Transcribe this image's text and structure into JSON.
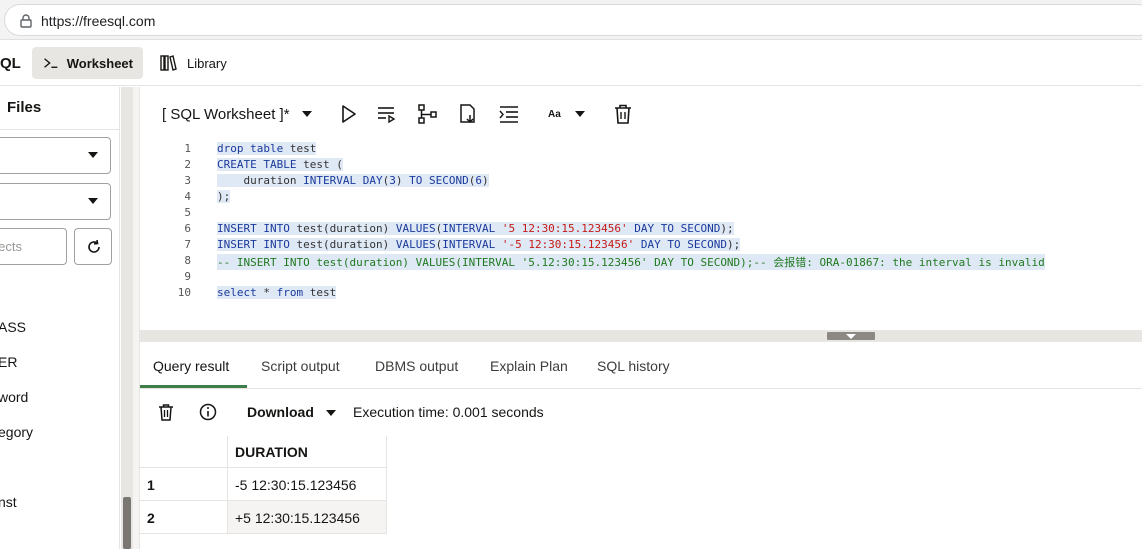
{
  "browser": {
    "url": "https://freesql.com"
  },
  "app": {
    "brand": "QL",
    "tabs": [
      {
        "label": "Worksheet",
        "icon": "terminal-icon",
        "active": true
      },
      {
        "label": "Library",
        "icon": "library-icon",
        "active": false
      }
    ]
  },
  "left_panel": {
    "title": "Files",
    "search_placeholder": "bjects",
    "items": [
      "ASS",
      "ER",
      "word",
      "egory",
      "nst"
    ]
  },
  "editor": {
    "title": "[ SQL Worksheet ]*",
    "font_button": "Aa",
    "line_numbers": [
      "1",
      "2",
      "3",
      "4",
      "5",
      "6",
      "7",
      "8",
      "9",
      "10"
    ],
    "lines": [
      "drop table test",
      "CREATE TABLE test (",
      "    duration INTERVAL DAY(3) TO SECOND(6)",
      ");",
      "",
      "INSERT INTO test(duration) VALUES(INTERVAL '5 12:30:15.123456' DAY TO SECOND);",
      "INSERT INTO test(duration) VALUES(INTERVAL '-5 12:30:15.123456' DAY TO SECOND);",
      "-- INSERT INTO test(duration) VALUES(INTERVAL '5.12:30:15.123456' DAY TO SECOND);-- 会报错: ORA-01867: the interval is invalid",
      "",
      "select * from test"
    ]
  },
  "output": {
    "tabs": [
      "Query result",
      "Script output",
      "DBMS output",
      "Explain Plan",
      "SQL history"
    ],
    "active_tab": "Query result",
    "download_label": "Download",
    "execution_time": "Execution time: 0.001 seconds",
    "columns": [
      "",
      "DURATION"
    ],
    "rows": [
      [
        "1",
        "-5 12:30:15.123456"
      ],
      [
        "2",
        "+5 12:30:15.123456"
      ]
    ]
  },
  "colors": {
    "accent": "#3e7d4a",
    "keyword": "#1a3a9c",
    "string": "#c41a16",
    "comment": "#1f7a1f",
    "selection": "#dfe8f5"
  }
}
